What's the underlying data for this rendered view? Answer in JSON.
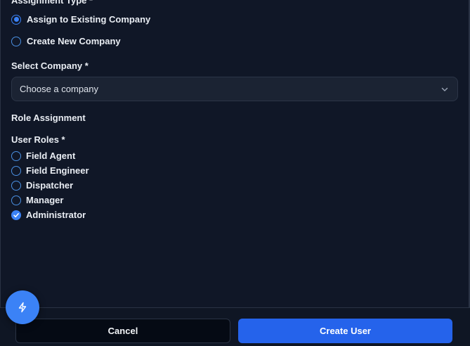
{
  "assignment": {
    "title": "Assignment Type *",
    "options": [
      {
        "label": "Assign to Existing Company",
        "selected": true
      },
      {
        "label": "Create New Company",
        "selected": false
      }
    ]
  },
  "company": {
    "label": "Select Company *",
    "placeholder": "Choose a company"
  },
  "role_assignment": {
    "title": "Role Assignment",
    "user_roles_label": "User Roles *",
    "roles": [
      {
        "label": "Field Agent",
        "checked": false
      },
      {
        "label": "Field Engineer",
        "checked": false
      },
      {
        "label": "Dispatcher",
        "checked": false
      },
      {
        "label": "Manager",
        "checked": false
      },
      {
        "label": "Administrator",
        "checked": true
      }
    ]
  },
  "footer": {
    "cancel_label": "Cancel",
    "create_label": "Create User"
  },
  "fab": {
    "icon": "lightning-icon"
  },
  "colors": {
    "background": "#101727",
    "accent": "#3b82f6",
    "primary_button": "#2563eb"
  }
}
